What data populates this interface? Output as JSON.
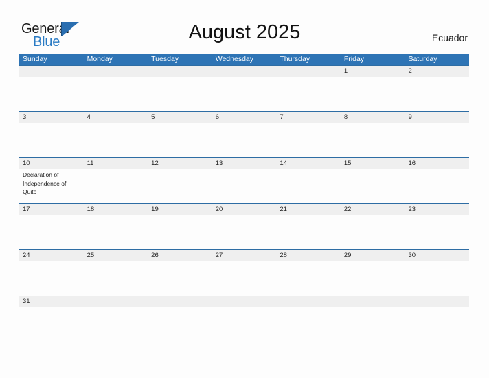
{
  "brand": {
    "name_part1": "General",
    "name_part2": "Blue",
    "logo_icon": "blue-triangle-logo"
  },
  "header": {
    "title": "August 2025",
    "locale": "Ecuador"
  },
  "calendar": {
    "weekdays": [
      "Sunday",
      "Monday",
      "Tuesday",
      "Wednesday",
      "Thursday",
      "Friday",
      "Saturday"
    ],
    "colors": {
      "header_blue": "#2e74b5",
      "rule_blue": "#2e6da4",
      "date_band_gray": "#efefef",
      "brand_blue": "#2a7bc4",
      "text_dark": "#1a1a1a"
    },
    "weeks": [
      {
        "days": [
          {
            "date": "",
            "event": ""
          },
          {
            "date": "",
            "event": ""
          },
          {
            "date": "",
            "event": ""
          },
          {
            "date": "",
            "event": ""
          },
          {
            "date": "",
            "event": ""
          },
          {
            "date": "1",
            "event": ""
          },
          {
            "date": "2",
            "event": ""
          }
        ]
      },
      {
        "days": [
          {
            "date": "3",
            "event": ""
          },
          {
            "date": "4",
            "event": ""
          },
          {
            "date": "5",
            "event": ""
          },
          {
            "date": "6",
            "event": ""
          },
          {
            "date": "7",
            "event": ""
          },
          {
            "date": "8",
            "event": ""
          },
          {
            "date": "9",
            "event": ""
          }
        ]
      },
      {
        "days": [
          {
            "date": "10",
            "event": "Declaration of Independence of Quito"
          },
          {
            "date": "11",
            "event": ""
          },
          {
            "date": "12",
            "event": ""
          },
          {
            "date": "13",
            "event": ""
          },
          {
            "date": "14",
            "event": ""
          },
          {
            "date": "15",
            "event": ""
          },
          {
            "date": "16",
            "event": ""
          }
        ]
      },
      {
        "days": [
          {
            "date": "17",
            "event": ""
          },
          {
            "date": "18",
            "event": ""
          },
          {
            "date": "19",
            "event": ""
          },
          {
            "date": "20",
            "event": ""
          },
          {
            "date": "21",
            "event": ""
          },
          {
            "date": "22",
            "event": ""
          },
          {
            "date": "23",
            "event": ""
          }
        ]
      },
      {
        "days": [
          {
            "date": "24",
            "event": ""
          },
          {
            "date": "25",
            "event": ""
          },
          {
            "date": "26",
            "event": ""
          },
          {
            "date": "27",
            "event": ""
          },
          {
            "date": "28",
            "event": ""
          },
          {
            "date": "29",
            "event": ""
          },
          {
            "date": "30",
            "event": ""
          }
        ]
      },
      {
        "days": [
          {
            "date": "31",
            "event": ""
          },
          {
            "date": "",
            "event": ""
          },
          {
            "date": "",
            "event": ""
          },
          {
            "date": "",
            "event": ""
          },
          {
            "date": "",
            "event": ""
          },
          {
            "date": "",
            "event": ""
          },
          {
            "date": "",
            "event": ""
          }
        ]
      }
    ]
  }
}
